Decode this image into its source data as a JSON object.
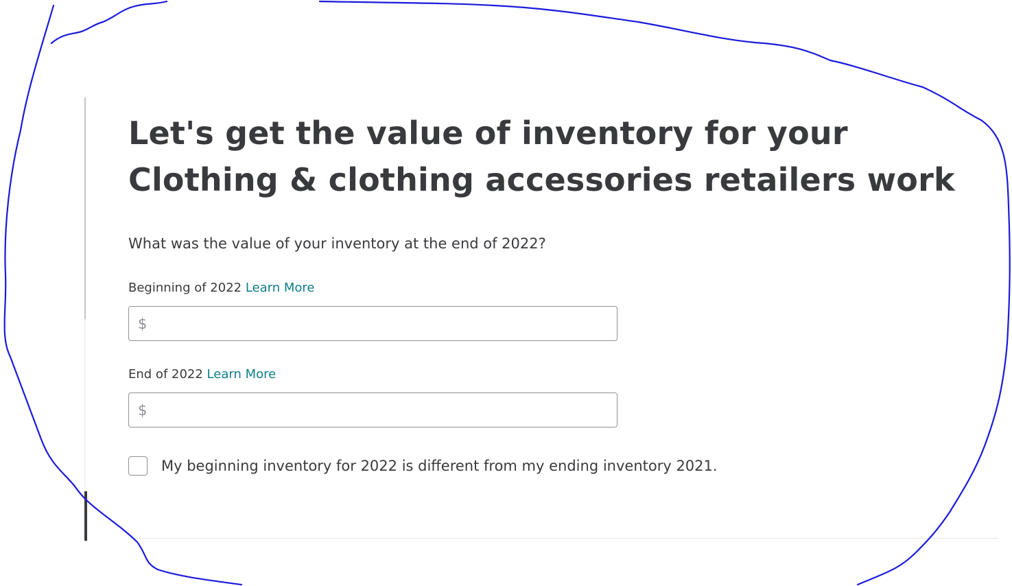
{
  "page": {
    "title": "Let's get the value of inventory for your Clothing & clothing accessories retailers work",
    "question": "What was the value of your inventory at the end of 2022?"
  },
  "fields": [
    {
      "label": "Beginning of 2022",
      "link": "Learn More",
      "currency_symbol": "$",
      "value": ""
    },
    {
      "label": "End of 2022",
      "link": "Learn More",
      "currency_symbol": "$",
      "value": ""
    }
  ],
  "checkbox": {
    "label": "My beginning inventory for 2022 is different from my ending inventory 2021.",
    "checked": false
  },
  "colors": {
    "text": "#393a3d",
    "link": "#0d7e8a",
    "input_border": "#8d9096",
    "annotation_ink": "#1a1adb"
  }
}
